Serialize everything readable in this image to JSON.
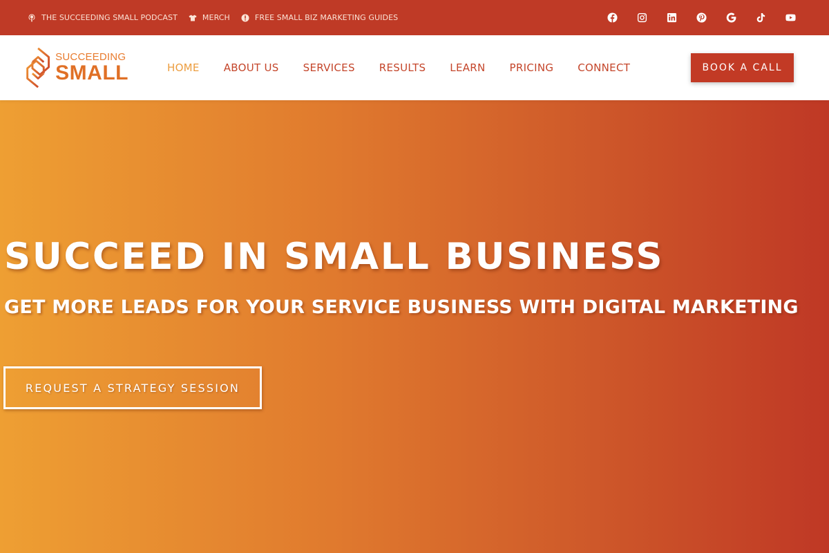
{
  "topbar": {
    "links": [
      {
        "label": "THE SUCCEEDING SMALL PODCAST",
        "icon": "podcast-icon"
      },
      {
        "label": "MERCH",
        "icon": "shirt-icon"
      },
      {
        "label": "FREE SMALL BIZ MARKETING GUIDES",
        "icon": "alert-icon"
      }
    ],
    "social": [
      "facebook-icon",
      "instagram-icon",
      "linkedin-icon",
      "pinterest-icon",
      "google-icon",
      "tiktok-icon",
      "youtube-icon"
    ]
  },
  "logo": {
    "top": "SUCCEEDING",
    "bottom": "SMALL"
  },
  "nav": {
    "items": [
      "HOME",
      "ABOUT US",
      "SERVICES",
      "RESULTS",
      "LEARN",
      "PRICING",
      "CONNECT"
    ],
    "active": "HOME"
  },
  "header": {
    "book_label": "BOOK A CALL"
  },
  "hero": {
    "title": "SUCCEED IN SMALL BUSINESS",
    "subtitle": "GET MORE LEADS FOR YOUR SERVICE BUSINESS WITH DIGITAL MARKETING",
    "cta_label": "REQUEST A STRATEGY SESSION"
  },
  "colors": {
    "topbar": "#bf3a26",
    "accent": "#c23a25",
    "nav_text": "#c4452a",
    "nav_active": "#ec9d3f",
    "hero_start": "#ee9f33",
    "hero_end": "#bf3825"
  }
}
